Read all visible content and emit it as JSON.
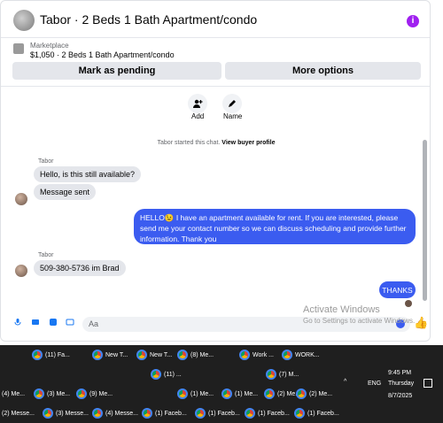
{
  "header": {
    "title": "Tabor · 2 Beds 1 Bath Apartment/condo"
  },
  "listing": {
    "label": "Marketplace",
    "price_title": "$1,050 · 2 Beds 1 Bath Apartment/condo"
  },
  "actions": {
    "pending_label": "Mark as pending",
    "more_label": "More options",
    "add_label": "Add",
    "name_label": "Name"
  },
  "system": {
    "started_text": "Tabor started this chat.",
    "view_profile_text": "View buyer profile"
  },
  "messages": [
    {
      "sender": "Tabor",
      "text": "Hello, is this still available?"
    },
    {
      "text": "Message sent"
    },
    {
      "text": "HELLO😉 I have an apartment available for rent. If you are interested, please send me your contact number so we can discuss scheduling and provide further information. Thank you"
    },
    {
      "sender": "Tabor",
      "text": "509-380-5736 im Brad"
    },
    {
      "text": "THANKS"
    }
  ],
  "composer": {
    "placeholder": "Aa"
  },
  "watermark": {
    "line1": "Activate Windows",
    "line2": "Go to Settings to activate Windows."
  },
  "taskbar": {
    "row1": [
      "(11) Fa...",
      "New T...",
      "New T...",
      "(8) Me...",
      "Work ...",
      "WORK..."
    ],
    "row2": [
      "(11) ...",
      "(7) M..."
    ],
    "row3": [
      "(4) Me...",
      "(3) Me...",
      "(9) Me...",
      "(1) Me...",
      "(1) Me...",
      "(2) Me...",
      "(2) Me..."
    ],
    "row4": [
      "(2) Messe...",
      "(3) Messe...",
      "(4) Messe...",
      "(1) Faceb...",
      "(1) Faceb...",
      "(1) Faceb...",
      "(1) Faceb..."
    ],
    "lang": "ENG",
    "time": "9:45 PM",
    "day": "Thursday",
    "date": "8/7/2025"
  },
  "colors": {
    "accent": "#3b5cf0",
    "info": "#a020f0",
    "bubble_in": "#e4e6eb"
  }
}
